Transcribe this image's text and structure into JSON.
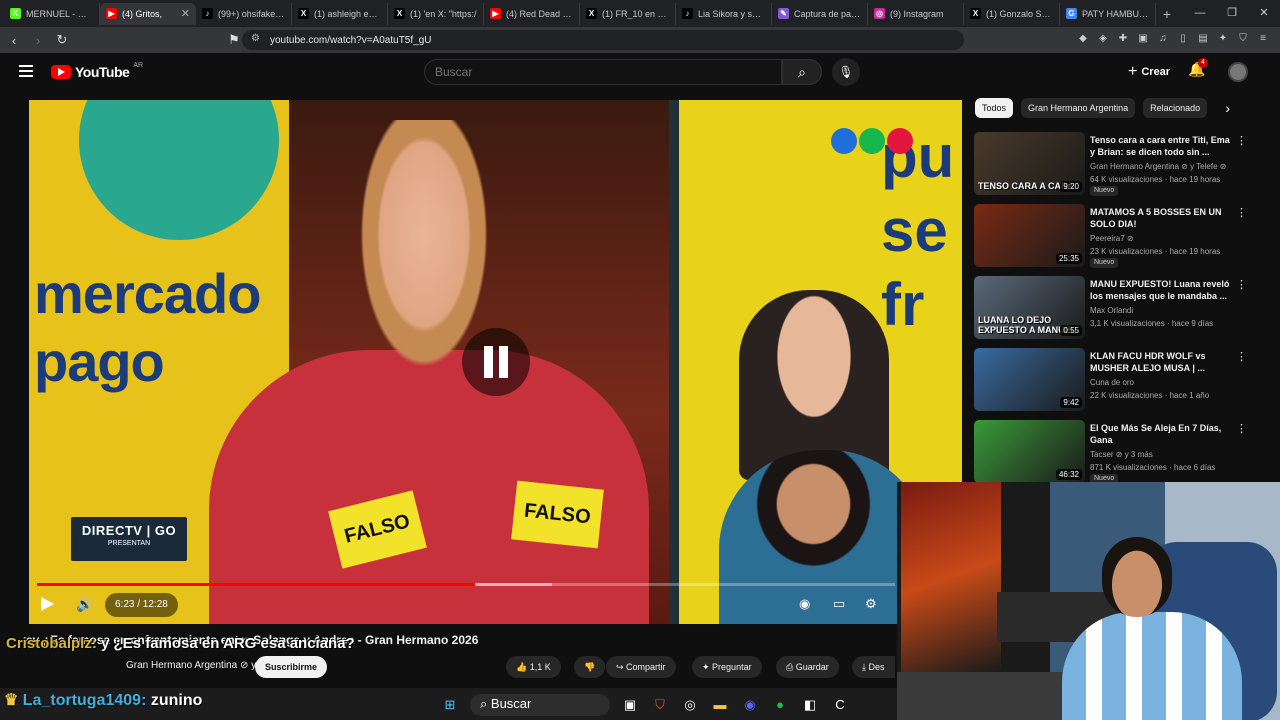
{
  "browser": {
    "tabs": [
      {
        "label": "MERNUEL - Watc",
        "icon": "kick-icon",
        "color": "#53fc18",
        "letter": "K"
      },
      {
        "label": "(4) Gritos,",
        "icon": "youtube-icon",
        "color": "#ff0000",
        "letter": "▶",
        "active": true
      },
      {
        "label": "(99+) ohsifake (@",
        "icon": "tiktok-icon",
        "color": "#000000",
        "letter": "♪"
      },
      {
        "label": "(1) ashleigh en X",
        "icon": "x-icon",
        "color": "#000000",
        "letter": "X"
      },
      {
        "label": "(1) 'en X: \"https:/",
        "icon": "x-icon",
        "color": "#000000",
        "letter": "X"
      },
      {
        "label": "(4) Red Dead Red",
        "icon": "youtube-icon",
        "color": "#ff0000",
        "letter": "▶"
      },
      {
        "label": "(1) FR_10 en X: \"(",
        "icon": "x-icon",
        "color": "#000000",
        "letter": "X"
      },
      {
        "label": "Lia Sikora y su se",
        "icon": "tiktok-icon",
        "color": "#000000",
        "letter": "♪"
      },
      {
        "label": "Captura de panta",
        "icon": "pen-icon",
        "color": "#7b5bd6",
        "letter": "✎"
      },
      {
        "label": "(9) Instagram",
        "icon": "instagram-icon",
        "color": "#d6249f",
        "letter": "◎"
      },
      {
        "label": "(1) Gonzalo Sotel",
        "icon": "x-icon",
        "color": "#000000",
        "letter": "X"
      },
      {
        "label": "PATY HAMBURGU",
        "icon": "google-icon",
        "color": "#4285f4",
        "letter": "G"
      }
    ],
    "url": "youtube.com/watch?v=A0atuT5f_gU"
  },
  "youtube": {
    "logo_text": "YouTube",
    "country": "AR",
    "search_placeholder": "Buscar",
    "create_label": "Crear",
    "notifications": "4"
  },
  "player": {
    "time": "6:23 / 12:28",
    "progress": 0.51,
    "buffered": 0.6,
    "overlay_left": "mercado\npago",
    "overlay_right": "pu\nse\nfr",
    "falso1": "FALSO",
    "falso2": "FALSO",
    "sponsor_line1": "DIRECTV | GO",
    "sponsor_line2": "PRESENTAN"
  },
  "video": {
    "title_visible": "ey  ¿Es famosa en  enfrentamiento entre Solange y Andrea - Gran Hermano 2026",
    "channel": "Gran Hermano Argentina ⊘ y Telefe ⊘",
    "subscribe_label": "Suscribirme",
    "likes": "1,1 K",
    "share_label": "Compartir",
    "ask_label": "Preguntar",
    "save_label": "Guardar",
    "download_label": "Des"
  },
  "sidebar": {
    "chips": [
      "Todos",
      "Gran Hermano Argentina",
      "Relacionado"
    ],
    "items": [
      {
        "title": "Tenso cara a cara entre Titi, Ema y Brian: se dicen todo sin ...",
        "channel": "Gran Hermano Argentina ⊘ y Telefe ⊘",
        "stats": "64 K visualizaciones · hace 19 horas",
        "badge": "Nuevo",
        "duration": "9:20",
        "thumb_text": "TENSO CARA A CARA",
        "thumb_color": "#4a3a2a"
      },
      {
        "title": "MATAMOS A 5 BOSSES EN UN SOLO DIA!",
        "channel": "Peereira7 ⊘",
        "stats": "23 K visualizaciones · hace 19 horas",
        "badge": "Nuevo",
        "duration": "25:35",
        "thumb_text": "",
        "thumb_color": "#7a2a14"
      },
      {
        "title": "MANU EXPUESTO! Luana reveló los mensajes que le mandaba ...",
        "channel": "Max Orlandi",
        "stats": "3,1 K visualizaciones · hace 9 días",
        "badge": "",
        "duration": "0:55",
        "thumb_text": "LUANA LO DEJO EXPUESTO A MANUEL",
        "thumb_color": "#5a6a7a"
      },
      {
        "title": "KLAN FACU HDR WOLF vs MUSHER ALEJO MUSA | ...",
        "channel": "Cuna de oro",
        "stats": "22 K visualizaciones · hace 1 año",
        "badge": "",
        "duration": "9:42",
        "thumb_text": "",
        "thumb_color": "#3a6aa0"
      },
      {
        "title": "El Que Más Se Aleja En 7 Días, Gana",
        "channel": "Tacser ⊘ y 3 más",
        "stats": "871 K visualizaciones · hace 6 días",
        "badge": "Nuevo",
        "duration": "46:32",
        "thumb_text": "",
        "thumb_color": "#3a9a3a"
      }
    ]
  },
  "overlay_chat": {
    "line1_user": "Cristobalplz:",
    "line1_text": " y ¿Es famosa en ARG esa anciana?",
    "line2_user": "La_tortuga1409:",
    "line2_text": " zunino"
  },
  "taskbar": {
    "search_placeholder": "Buscar"
  }
}
